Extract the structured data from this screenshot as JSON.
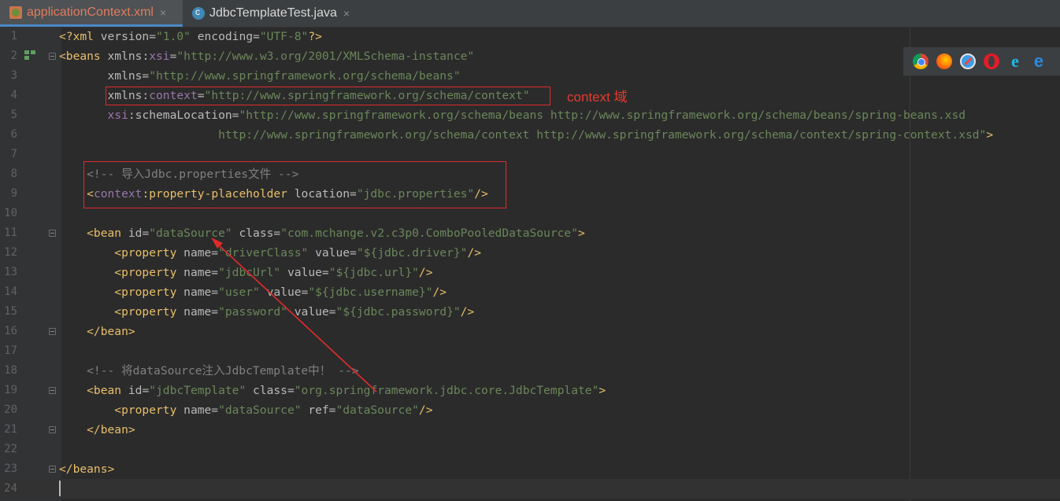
{
  "tabs": [
    {
      "label": "applicationContext.xml",
      "icon": "xml-file-icon",
      "active": true
    },
    {
      "label": "JdbcTemplateTest.java",
      "icon": "java-class-icon",
      "active": false
    }
  ],
  "close_glyph": "×",
  "annotation_label": "context 域",
  "browsers": [
    "chrome-icon",
    "firefox-icon",
    "safari-icon",
    "opera-icon",
    "internet-explorer-icon",
    "edge-icon"
  ],
  "lines": [
    {
      "n": "1",
      "tokens": [
        [
          "tag",
          "<?xml "
        ],
        [
          "attr",
          "version="
        ],
        [
          "val",
          "\"1.0\""
        ],
        [
          "attr",
          " encoding="
        ],
        [
          "val",
          "\"UTF-8\""
        ],
        [
          "tag",
          "?>"
        ]
      ]
    },
    {
      "n": "2",
      "tokens": [
        [
          "tag",
          "<beans "
        ],
        [
          "attr",
          "xmlns:"
        ],
        [
          "ns",
          "xsi"
        ],
        [
          "attr",
          "="
        ],
        [
          "val",
          "\"http://www.w3.org/2001/XMLSchema-instance\""
        ]
      ]
    },
    {
      "n": "3",
      "tokens": [
        [
          "attr",
          "       xmlns="
        ],
        [
          "val",
          "\"http://www.springframework.org/schema/beans\""
        ]
      ]
    },
    {
      "n": "4",
      "tokens": [
        [
          "attr",
          "       xmlns:"
        ],
        [
          "ns",
          "context"
        ],
        [
          "attr",
          "="
        ],
        [
          "val",
          "\"http://www.springframework.org/schema/context\""
        ]
      ]
    },
    {
      "n": "5",
      "tokens": [
        [
          "ns",
          "       xsi"
        ],
        [
          "attr",
          ":schemaLocation="
        ],
        [
          "val",
          "\"http://www.springframework.org/schema/beans http://www.springframework.org/schema/beans/spring-beans.xsd"
        ]
      ]
    },
    {
      "n": "6",
      "tokens": [
        [
          "val",
          "                       http://www.springframework.org/schema/context http://www.springframework.org/schema/context/spring-context.xsd\""
        ],
        [
          "tag",
          ">"
        ]
      ]
    },
    {
      "n": "7",
      "tokens": []
    },
    {
      "n": "8",
      "tokens": [
        [
          "cmt",
          "    <!-- 导入Jdbc.properties文件 -->"
        ]
      ]
    },
    {
      "n": "9",
      "tokens": [
        [
          "tag",
          "    <"
        ],
        [
          "ns",
          "context"
        ],
        [
          "tag",
          ":property-placeholder "
        ],
        [
          "attr",
          "location="
        ],
        [
          "val",
          "\"jdbc.properties\""
        ],
        [
          "tag",
          "/>"
        ]
      ]
    },
    {
      "n": "10",
      "tokens": []
    },
    {
      "n": "11",
      "tokens": [
        [
          "tag",
          "    <bean "
        ],
        [
          "attr",
          "id="
        ],
        [
          "val",
          "\"dataSource\""
        ],
        [
          "attr",
          " class="
        ],
        [
          "val",
          "\"com.mchange.v2.c3p0.ComboPooledDataSource\""
        ],
        [
          "tag",
          ">"
        ]
      ]
    },
    {
      "n": "12",
      "tokens": [
        [
          "tag",
          "        <property "
        ],
        [
          "attr",
          "name="
        ],
        [
          "val",
          "\"driverClass\""
        ],
        [
          "attr",
          " value="
        ],
        [
          "val",
          "\"${jdbc.driver}\""
        ],
        [
          "tag",
          "/>"
        ]
      ]
    },
    {
      "n": "13",
      "tokens": [
        [
          "tag",
          "        <property "
        ],
        [
          "attr",
          "name="
        ],
        [
          "val",
          "\"jdbcUrl\""
        ],
        [
          "attr",
          " value="
        ],
        [
          "val",
          "\"${jdbc.url}\""
        ],
        [
          "tag",
          "/>"
        ]
      ]
    },
    {
      "n": "14",
      "tokens": [
        [
          "tag",
          "        <property "
        ],
        [
          "attr",
          "name="
        ],
        [
          "val",
          "\"user\""
        ],
        [
          "attr",
          " value="
        ],
        [
          "val",
          "\"${jdbc.username}\""
        ],
        [
          "tag",
          "/>"
        ]
      ]
    },
    {
      "n": "15",
      "tokens": [
        [
          "tag",
          "        <property "
        ],
        [
          "attr",
          "name="
        ],
        [
          "val",
          "\"password\""
        ],
        [
          "attr",
          " value="
        ],
        [
          "val",
          "\"${jdbc.password}\""
        ],
        [
          "tag",
          "/>"
        ]
      ]
    },
    {
      "n": "16",
      "tokens": [
        [
          "tag",
          "    </bean>"
        ]
      ]
    },
    {
      "n": "17",
      "tokens": []
    },
    {
      "n": "18",
      "tokens": [
        [
          "cmt",
          "    <!-- 将dataSource注入JdbcTemplate中！ -->"
        ]
      ]
    },
    {
      "n": "19",
      "tokens": [
        [
          "tag",
          "    <bean "
        ],
        [
          "attr",
          "id="
        ],
        [
          "val",
          "\"jdbcTemplate\""
        ],
        [
          "attr",
          " class="
        ],
        [
          "val",
          "\"org.springframework.jdbc.core.JdbcTemplate\""
        ],
        [
          "tag",
          ">"
        ]
      ]
    },
    {
      "n": "20",
      "tokens": [
        [
          "tag",
          "        <property "
        ],
        [
          "attr",
          "name="
        ],
        [
          "val",
          "\"dataSource\""
        ],
        [
          "attr",
          " ref="
        ],
        [
          "val",
          "\"dataSource\""
        ],
        [
          "tag",
          "/>"
        ]
      ]
    },
    {
      "n": "21",
      "tokens": [
        [
          "tag",
          "    </bean>"
        ]
      ]
    },
    {
      "n": "22",
      "tokens": []
    },
    {
      "n": "23",
      "tokens": [
        [
          "tag",
          "</beans>"
        ]
      ]
    },
    {
      "n": "24",
      "tokens": []
    }
  ]
}
